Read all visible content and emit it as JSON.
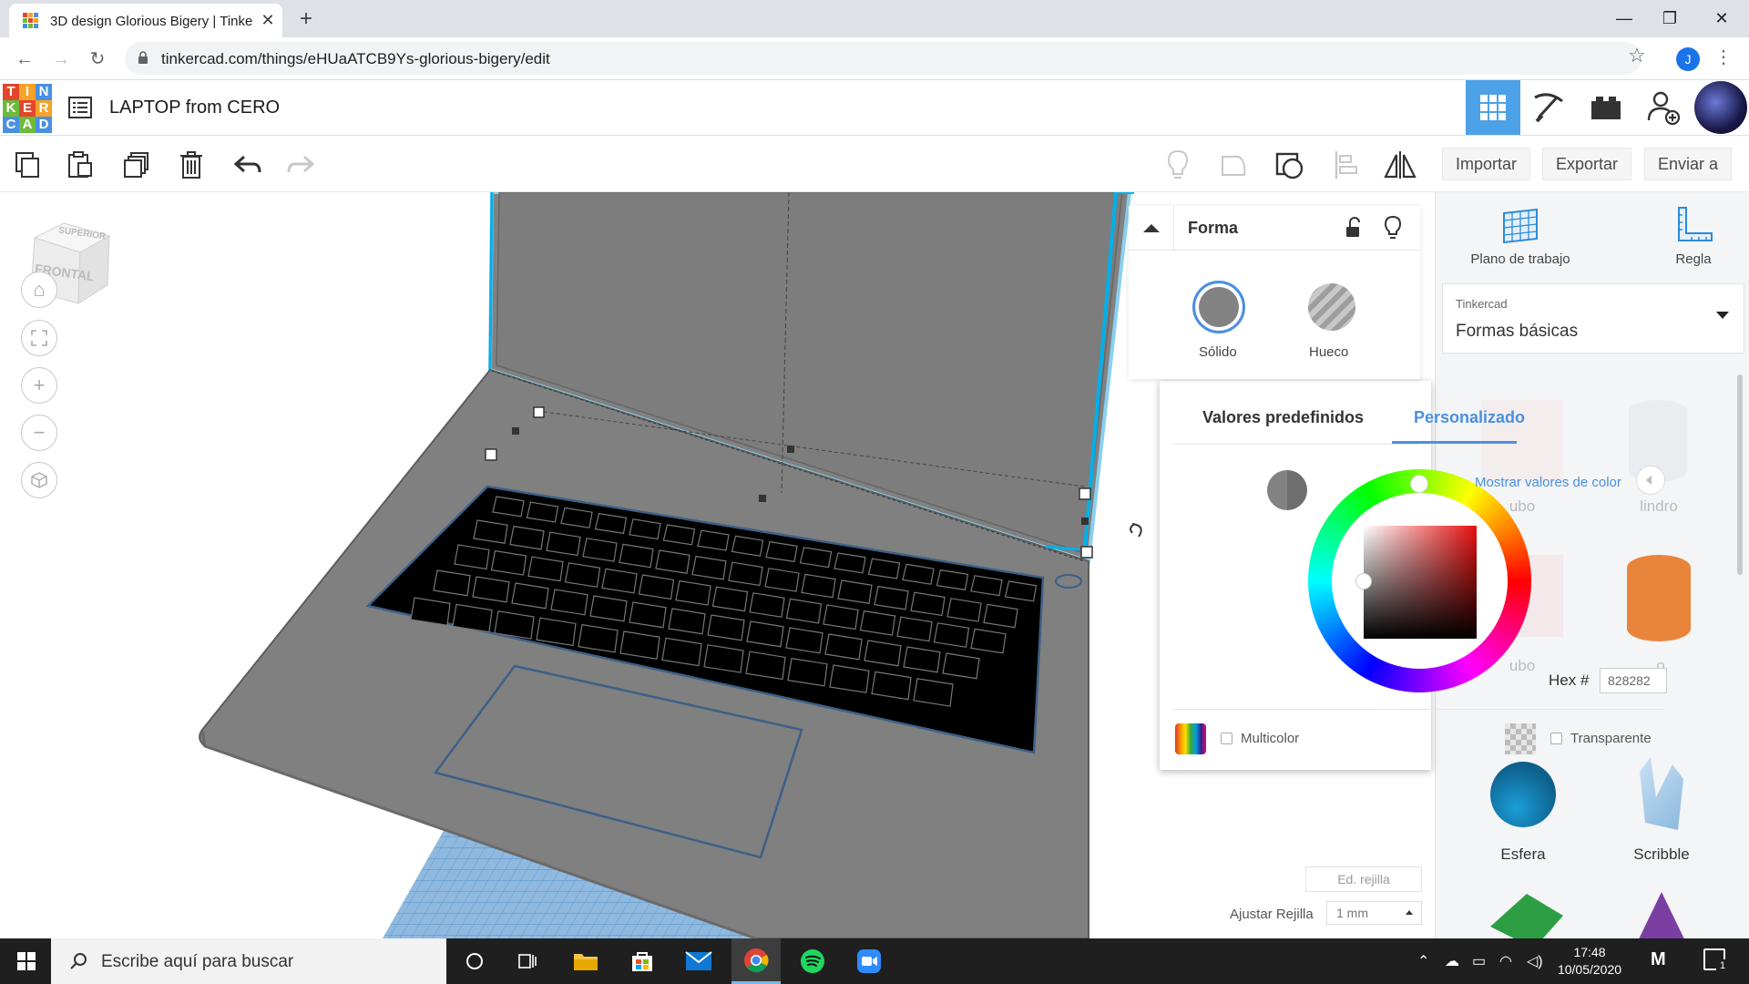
{
  "browser": {
    "tab_title": "3D design Glorious Bigery | Tinke",
    "tab_close": "✕",
    "new_tab": "+",
    "url": "tinkercad.com/things/eHUaATCB9Ys-glorious-bigery/edit",
    "profile_initial": "J",
    "window_controls": {
      "minimize": "—",
      "maximize": "❐",
      "close": "✕"
    }
  },
  "header": {
    "logo_letters": [
      "T",
      "I",
      "N",
      "K",
      "E",
      "R",
      "C",
      "A",
      "D"
    ],
    "logo_colors": [
      "#e2462b",
      "#f7a22b",
      "#4a90e2",
      "#6cbb3c",
      "#e2462b",
      "#f7a22b",
      "#4a90e2",
      "#6cbb3c",
      "#4a90e2"
    ],
    "design_title": "LAPTOP from CERO",
    "active_view": "grid-view",
    "views": [
      "grid-view-icon",
      "pickaxe-icon",
      "bricks-icon",
      "add-user-icon"
    ]
  },
  "toolbar": {
    "import_label": "Importar",
    "export_label": "Exportar",
    "send_label": "Enviar a"
  },
  "viewcube": {
    "top": "SUPERIOR",
    "front": "FRONTAL"
  },
  "inspector": {
    "title": "Forma",
    "solid_label": "Sólido",
    "hole_label": "Hueco",
    "tab_presets": "Valores predefinidos",
    "tab_custom": "Personalizado",
    "show_values": "Mostrar valores de color",
    "hex_label": "Hex #",
    "hex_value": "828282",
    "current_color": "#828282",
    "multicolor_label": "Multicolor",
    "transparent_label": "Transparente"
  },
  "workplane": {
    "edit_grid": "Ed. rejilla",
    "snap_label": "Ajustar Rejilla",
    "snap_value": "1 mm"
  },
  "library": {
    "workplane_label": "Plano de trabajo",
    "ruler_label": "Regla",
    "source_small": "Tinkercad",
    "source_main": "Formas básicas",
    "shapes": [
      "Esfera",
      "Scribble"
    ],
    "hidden_fragments": [
      "ubo",
      "lindro",
      "ubo",
      "o"
    ]
  },
  "taskbar": {
    "search_placeholder": "Escribe aquí para buscar",
    "time": "17:48",
    "date": "10/05/2020",
    "notifications": "1"
  }
}
